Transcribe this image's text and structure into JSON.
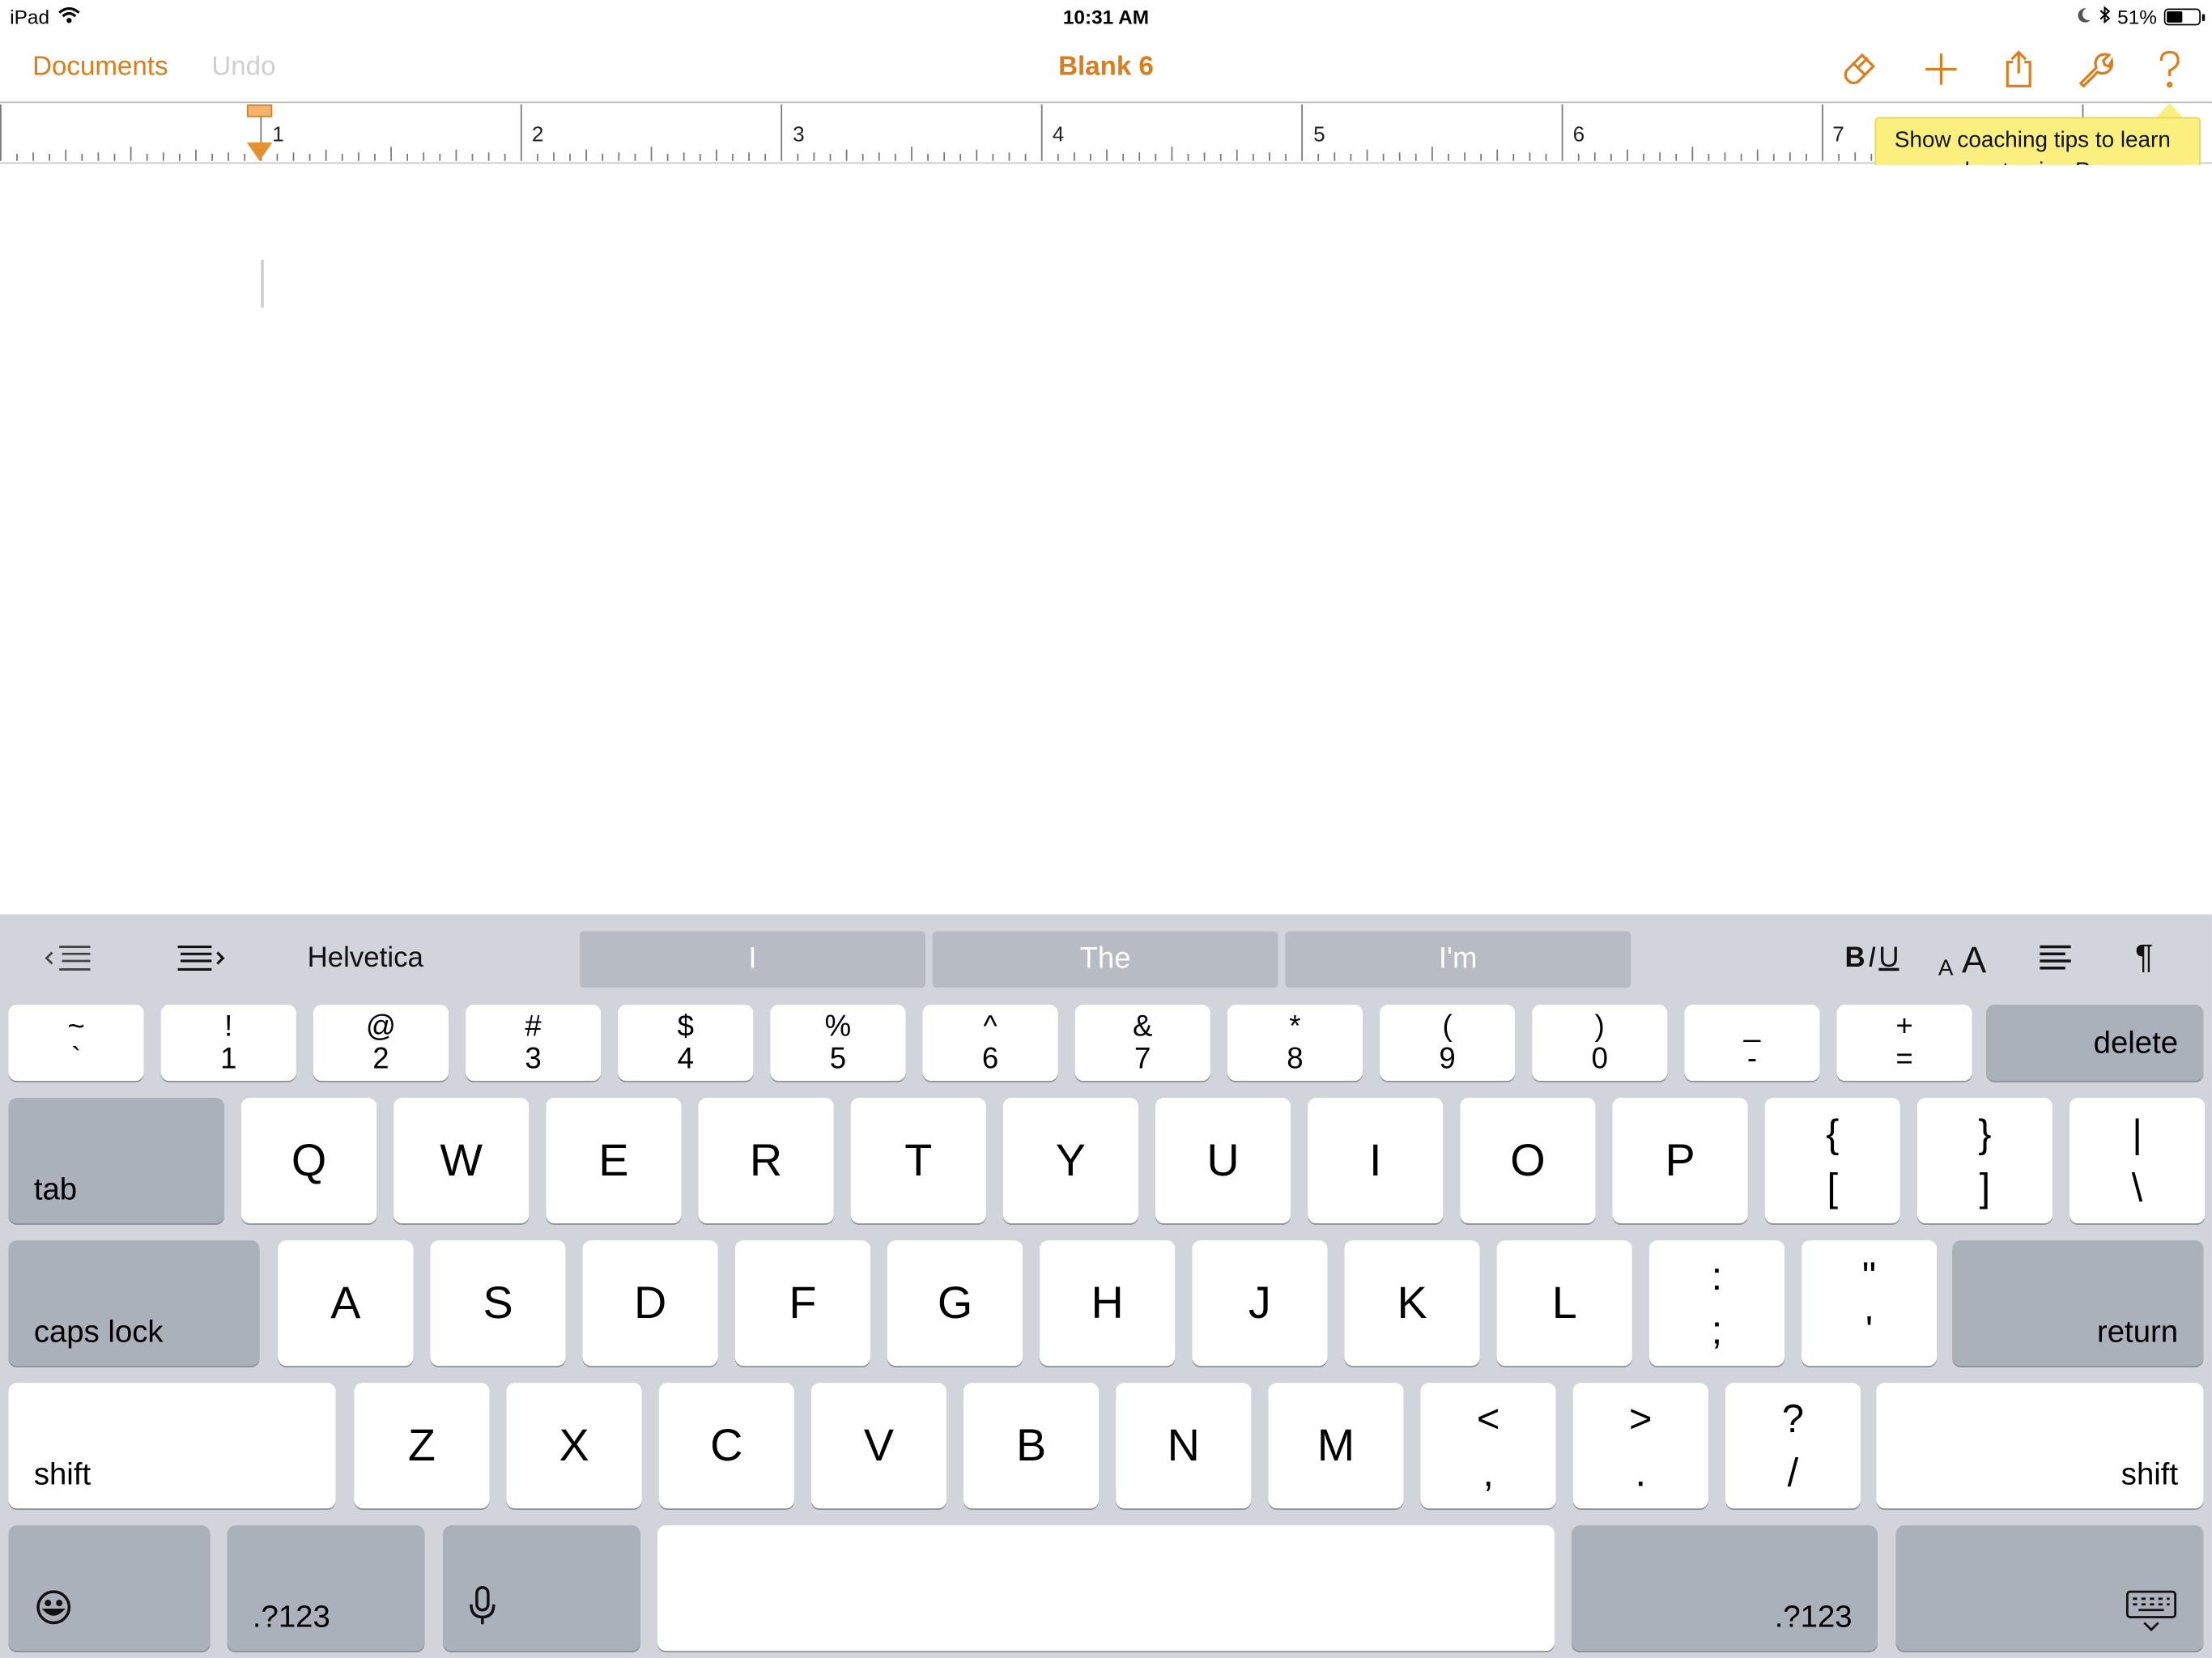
{
  "status_bar": {
    "device": "iPad",
    "time": "10:31 AM",
    "battery_text": "51%",
    "battery_level": 0.51
  },
  "nav": {
    "documents_label": "Documents",
    "undo_label": "Undo",
    "title": "Blank 6",
    "icons": [
      "paintbrush-icon",
      "plus-icon",
      "share-icon",
      "wrench-icon",
      "help-icon"
    ],
    "accent_color": "#e07b16"
  },
  "ruler": {
    "numbers": [
      "1",
      "2",
      "3",
      "4",
      "5",
      "6",
      "7"
    ]
  },
  "tooltip": {
    "text": "Show coaching tips to learn more about using Pages."
  },
  "shortcut_bar": {
    "font_name": "Helvetica",
    "suggestions": [
      "I",
      "The",
      "I'm"
    ],
    "bold": "B",
    "italic": "I",
    "underline": "U",
    "font_size_small": "A",
    "font_size_large": "A",
    "paragraph_symbol": "¶"
  },
  "keyboard": {
    "number_row": [
      {
        "top": "~",
        "bottom": "`"
      },
      {
        "top": "!",
        "bottom": "1"
      },
      {
        "top": "@",
        "bottom": "2"
      },
      {
        "top": "#",
        "bottom": "3"
      },
      {
        "top": "$",
        "bottom": "4"
      },
      {
        "top": "%",
        "bottom": "5"
      },
      {
        "top": "^",
        "bottom": "6"
      },
      {
        "top": "&",
        "bottom": "7"
      },
      {
        "top": "*",
        "bottom": "8"
      },
      {
        "top": "(",
        "bottom": "9"
      },
      {
        "top": ")",
        "bottom": "0"
      },
      {
        "top": "_",
        "bottom": "-"
      },
      {
        "top": "+",
        "bottom": "="
      }
    ],
    "delete_label": "delete",
    "tab_label": "tab",
    "row_q": [
      "Q",
      "W",
      "E",
      "R",
      "T",
      "Y",
      "U",
      "I",
      "O",
      "P"
    ],
    "row_q_symbols": [
      {
        "top": "{",
        "bottom": "["
      },
      {
        "top": "}",
        "bottom": "]"
      },
      {
        "top": "|",
        "bottom": "\\"
      }
    ],
    "caps_lock_label": "caps lock",
    "row_a": [
      "A",
      "S",
      "D",
      "F",
      "G",
      "H",
      "J",
      "K",
      "L"
    ],
    "row_a_symbols": [
      {
        "top": ":",
        "bottom": ";"
      },
      {
        "top": "\"",
        "bottom": "'"
      }
    ],
    "return_label": "return",
    "shift_label": "shift",
    "row_z": [
      "Z",
      "X",
      "C",
      "V",
      "B",
      "N",
      "M"
    ],
    "row_z_symbols": [
      {
        "top": "<",
        "bottom": ","
      },
      {
        "top": ">",
        "bottom": "."
      },
      {
        "top": "?",
        "bottom": "/"
      }
    ],
    "numbers_label": ".?123"
  }
}
